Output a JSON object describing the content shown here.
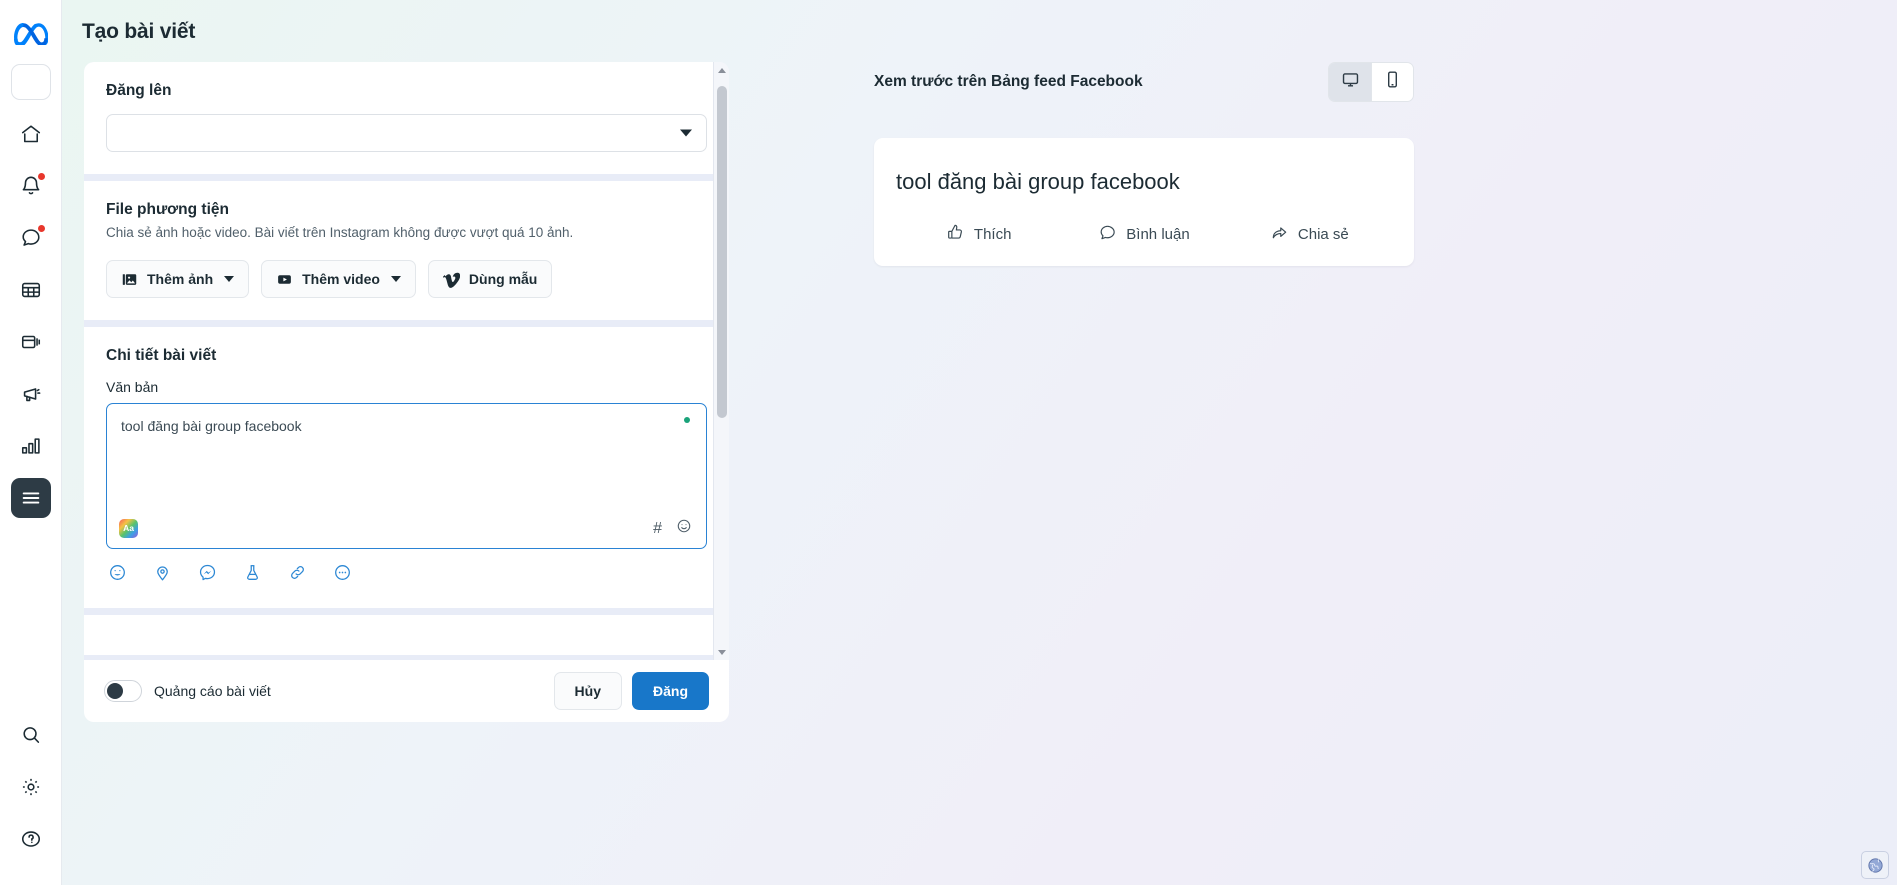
{
  "page": {
    "title": "Tạo bài viết"
  },
  "sidebar": {
    "logo": "meta-logo",
    "items": [
      {
        "name": "account-switcher",
        "icon": "account-box-icon",
        "label": "",
        "badge": false
      },
      {
        "name": "home",
        "icon": "home-icon",
        "label": "",
        "badge": false
      },
      {
        "name": "notifications",
        "icon": "bell-icon",
        "label": "",
        "badge": true
      },
      {
        "name": "messages",
        "icon": "chat-bubble-icon",
        "label": "",
        "badge": true
      },
      {
        "name": "planner",
        "icon": "calendar-grid-icon",
        "label": "",
        "badge": false
      },
      {
        "name": "content",
        "icon": "cards-stack-icon",
        "label": "",
        "badge": false
      },
      {
        "name": "ads",
        "icon": "megaphone-icon",
        "label": "",
        "badge": false
      },
      {
        "name": "insights",
        "icon": "bar-chart-icon",
        "label": "",
        "badge": false
      },
      {
        "name": "menu",
        "icon": "hamburger-menu-icon",
        "label": "",
        "badge": false
      }
    ],
    "bottom_items": [
      {
        "name": "search",
        "icon": "search-icon"
      },
      {
        "name": "settings",
        "icon": "gear-icon"
      },
      {
        "name": "help",
        "icon": "question-circle-icon"
      }
    ]
  },
  "composer": {
    "publish_to": {
      "title": "Đăng lên",
      "selected": "",
      "placeholder": ""
    },
    "media": {
      "title": "File phương tiện",
      "subtitle": "Chia sẻ ảnh hoặc video. Bài viết trên Instagram không được vượt quá 10 ảnh.",
      "buttons": [
        {
          "label": "Thêm ảnh",
          "icon": "photo-icon",
          "has_caret": true
        },
        {
          "label": "Thêm video",
          "icon": "video-play-icon",
          "has_caret": true
        },
        {
          "label": "Dùng mẫu",
          "icon": "vimeo-v-icon",
          "has_caret": false
        }
      ]
    },
    "details": {
      "title": "Chi tiết bài viết",
      "text_label": "Văn bản",
      "text_value": "tool đăng bài group facebook",
      "aa_chip_label": "Aa",
      "inline_tools": [
        {
          "name": "hashtag",
          "glyph": "#"
        },
        {
          "name": "emoji",
          "glyph": "emoji-icon"
        }
      ],
      "tool_row": [
        {
          "name": "emoji-icon"
        },
        {
          "name": "location-pin-icon"
        },
        {
          "name": "messenger-icon"
        },
        {
          "name": "flask-icon"
        },
        {
          "name": "link-icon"
        },
        {
          "name": "more-ellipsis-icon"
        }
      ]
    },
    "footer": {
      "boost_toggle_label": "Quảng cáo bài viết",
      "boost_toggle_on": false,
      "cancel_label": "Hủy",
      "publish_label": "Đăng"
    },
    "scrollbar": {
      "visible": true
    }
  },
  "preview": {
    "title": "Xem trước trên Bảng feed Facebook",
    "device_toggle": [
      {
        "name": "desktop",
        "icon": "monitor-icon",
        "active": true
      },
      {
        "name": "mobile",
        "icon": "phone-icon",
        "active": false
      }
    ],
    "card": {
      "text": "tool đăng bài group facebook",
      "actions": [
        {
          "label": "Thích",
          "icon": "thumbs-up-icon"
        },
        {
          "label": "Bình luận",
          "icon": "comment-bubble-icon"
        },
        {
          "label": "Chia sẻ",
          "icon": "share-arrow-icon"
        }
      ]
    }
  },
  "status": {
    "globe_badge": "globe-icon"
  },
  "colors": {
    "accent": "#1877c9",
    "rail_active": "#2d3b45",
    "focus_border": "#2a83d4",
    "badge_red": "#e8372c",
    "green_dot": "#1aa37a"
  }
}
